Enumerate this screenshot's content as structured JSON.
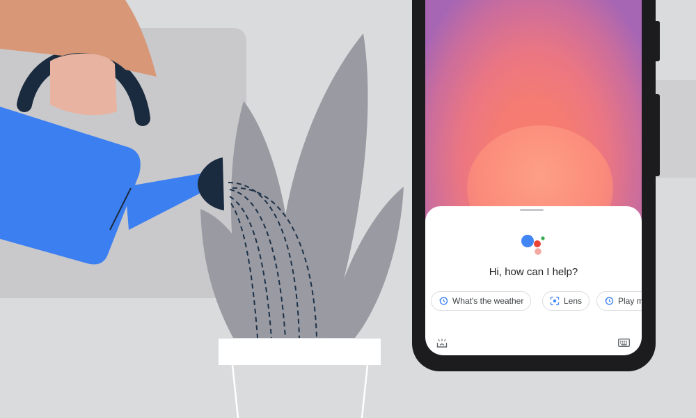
{
  "assistant": {
    "greeting": "Hi, how can I help?",
    "chips": [
      {
        "label": "What's the weather",
        "icon": "history-icon"
      },
      {
        "label": "Lens",
        "icon": "lens-icon"
      },
      {
        "label": "Play m",
        "icon": "history-icon"
      }
    ],
    "bottom_left_icon": "snapshot-icon",
    "bottom_right_icon": "keyboard-icon"
  },
  "colors": {
    "background": "#dadbdd",
    "watering_can": "#3b7ff0",
    "plant": "#9a9aa2",
    "google_blue": "#4285f4",
    "google_red": "#ea4335",
    "google_green": "#34a853"
  }
}
